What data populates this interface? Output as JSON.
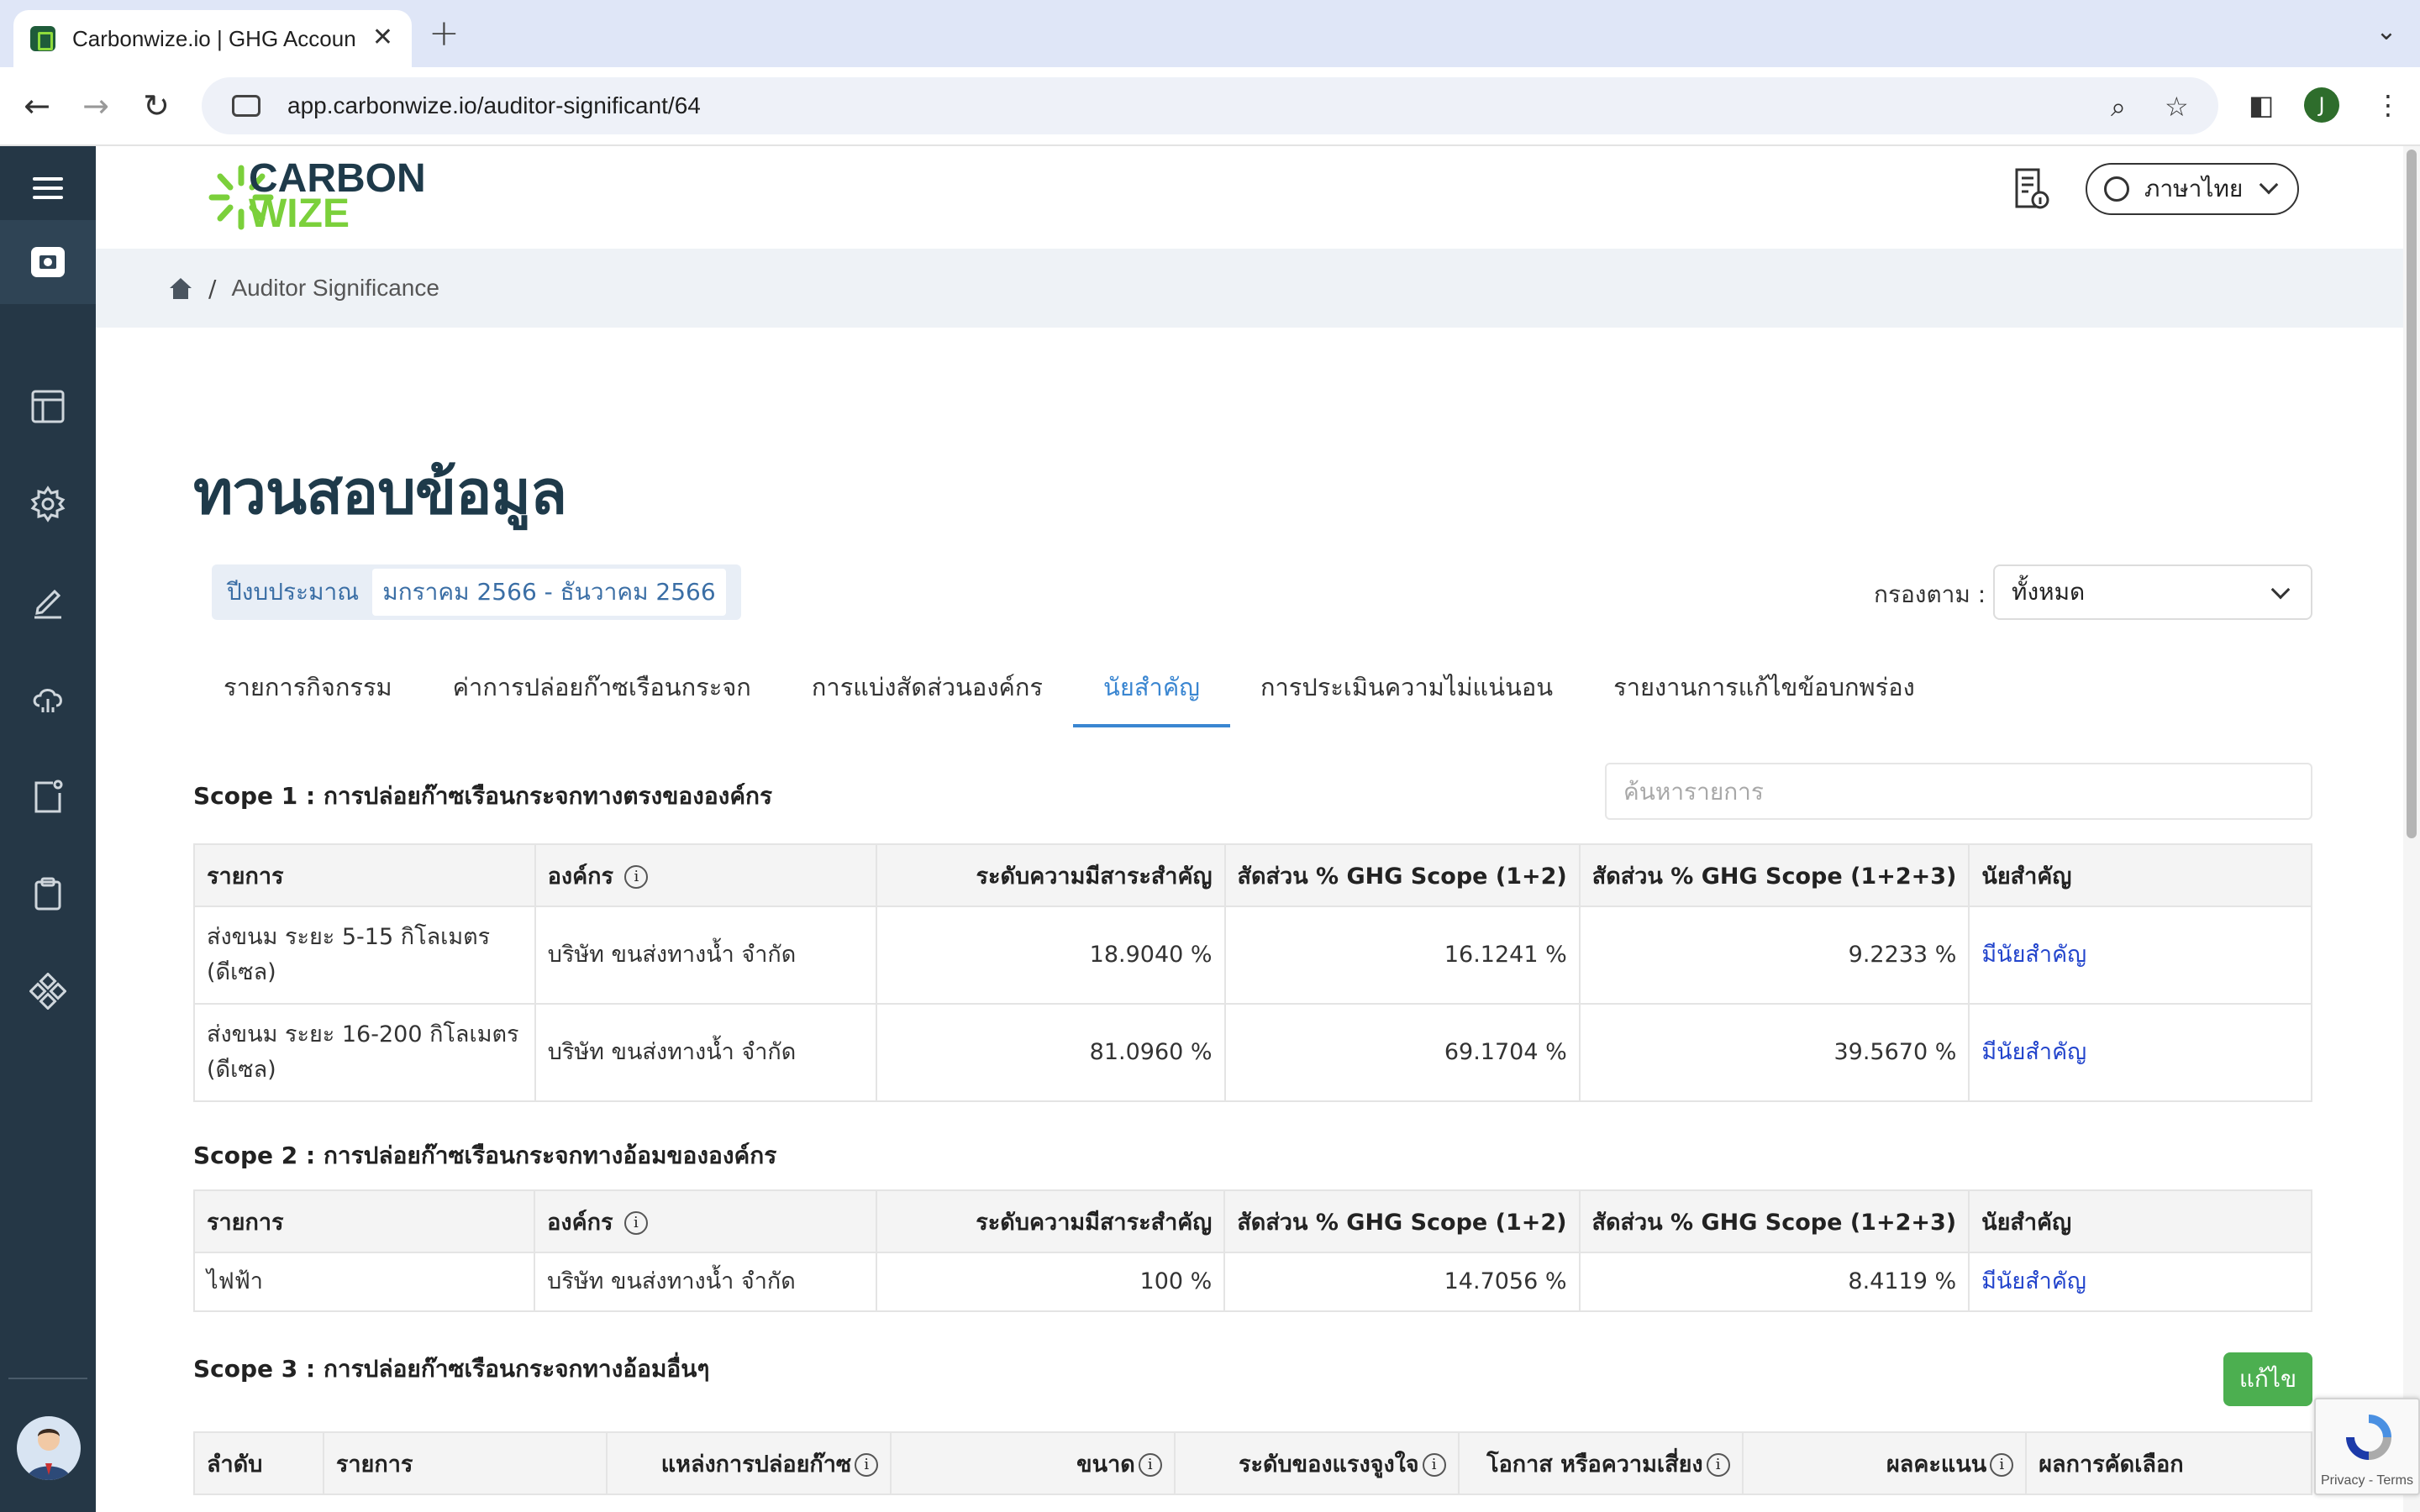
{
  "browser": {
    "tab_title": "Carbonwize.io | GHG Accoun",
    "url": "app.carbonwize.io/auditor-significant/64",
    "profile_initial": "J"
  },
  "header": {
    "logo_line1": "CARBON",
    "logo_line2": "WIZE",
    "language": "ภาษาไทย"
  },
  "breadcrumb": {
    "separator": "/",
    "current": "Auditor Significance"
  },
  "page": {
    "title": "ทวนสอบข้อมูล",
    "budget_label": "ปีงบประมาณ",
    "budget_value": "มกราคม 2566 - ธันวาคม 2566",
    "filter_label": "กรองตาม :",
    "filter_value": "ทั้งหมด"
  },
  "tabs": [
    {
      "label": "รายการกิจกรรม"
    },
    {
      "label": "ค่าการปล่อยก๊าซเรือนกระจก"
    },
    {
      "label": "การแบ่งสัดส่วนองค์กร"
    },
    {
      "label": "นัยสำคัญ"
    },
    {
      "label": "การประเมินความไม่แน่นอน"
    },
    {
      "label": "รายงานการแก้ไขข้อบกพร่อง"
    }
  ],
  "search": {
    "placeholder": "ค้นหารายการ"
  },
  "scope1": {
    "title": "Scope 1 : การปล่อยก๊าซเรือนกระจกทางตรงขององค์กร",
    "headers": [
      "รายการ",
      "องค์กร",
      "ระดับความมีสาระสำคัญ",
      "สัดส่วน % GHG Scope (1+2)",
      "สัดส่วน % GHG Scope (1+2+3)",
      "นัยสำคัญ"
    ],
    "rows": [
      {
        "item": "ส่งขนม ระยะ 5-15 กิโลเมตร (ดีเซล)",
        "org": "บริษัท ขนส่งทางน้ำ จำกัด",
        "materiality": "18.9040 %",
        "s12": "16.1241 %",
        "s123": "9.2233 %",
        "sig": "มีนัยสำคัญ"
      },
      {
        "item": "ส่งขนม ระยะ 16-200 กิโลเมตร (ดีเซล)",
        "org": "บริษัท ขนส่งทางน้ำ จำกัด",
        "materiality": "81.0960 %",
        "s12": "69.1704 %",
        "s123": "39.5670 %",
        "sig": "มีนัยสำคัญ"
      }
    ]
  },
  "scope2": {
    "title": "Scope 2 : การปล่อยก๊าซเรือนกระจกทางอ้อมขององค์กร",
    "headers": [
      "รายการ",
      "องค์กร",
      "ระดับความมีสาระสำคัญ",
      "สัดส่วน % GHG Scope (1+2)",
      "สัดส่วน % GHG Scope (1+2+3)",
      "นัยสำคัญ"
    ],
    "rows": [
      {
        "item": "ไฟฟ้า",
        "org": "บริษัท ขนส่งทางน้ำ จำกัด",
        "materiality": "100 %",
        "s12": "14.7056 %",
        "s123": "8.4119 %",
        "sig": "มีนัยสำคัญ"
      }
    ]
  },
  "scope3": {
    "title": "Scope 3 : การปล่อยก๊าซเรือนกระจกทางอ้อมอื่นๆ",
    "edit_label": "แก้ไข",
    "headers": [
      "ลำดับ",
      "รายการ",
      "แหล่งการปล่อยก๊าซ",
      "ขนาด",
      "ระดับของแรงจูงใจ",
      "โอกาส หรือความเสี่ยง",
      "ผลคะแนน",
      "ผลการคัดเลือก"
    ]
  },
  "recaptcha": {
    "text": "Privacy - Terms"
  },
  "colors": {
    "accent": "#3a86d1",
    "sidebar": "#253746",
    "brand_green": "#7bd03b",
    "edit_button": "#4caf50",
    "link": "#2244cc"
  }
}
